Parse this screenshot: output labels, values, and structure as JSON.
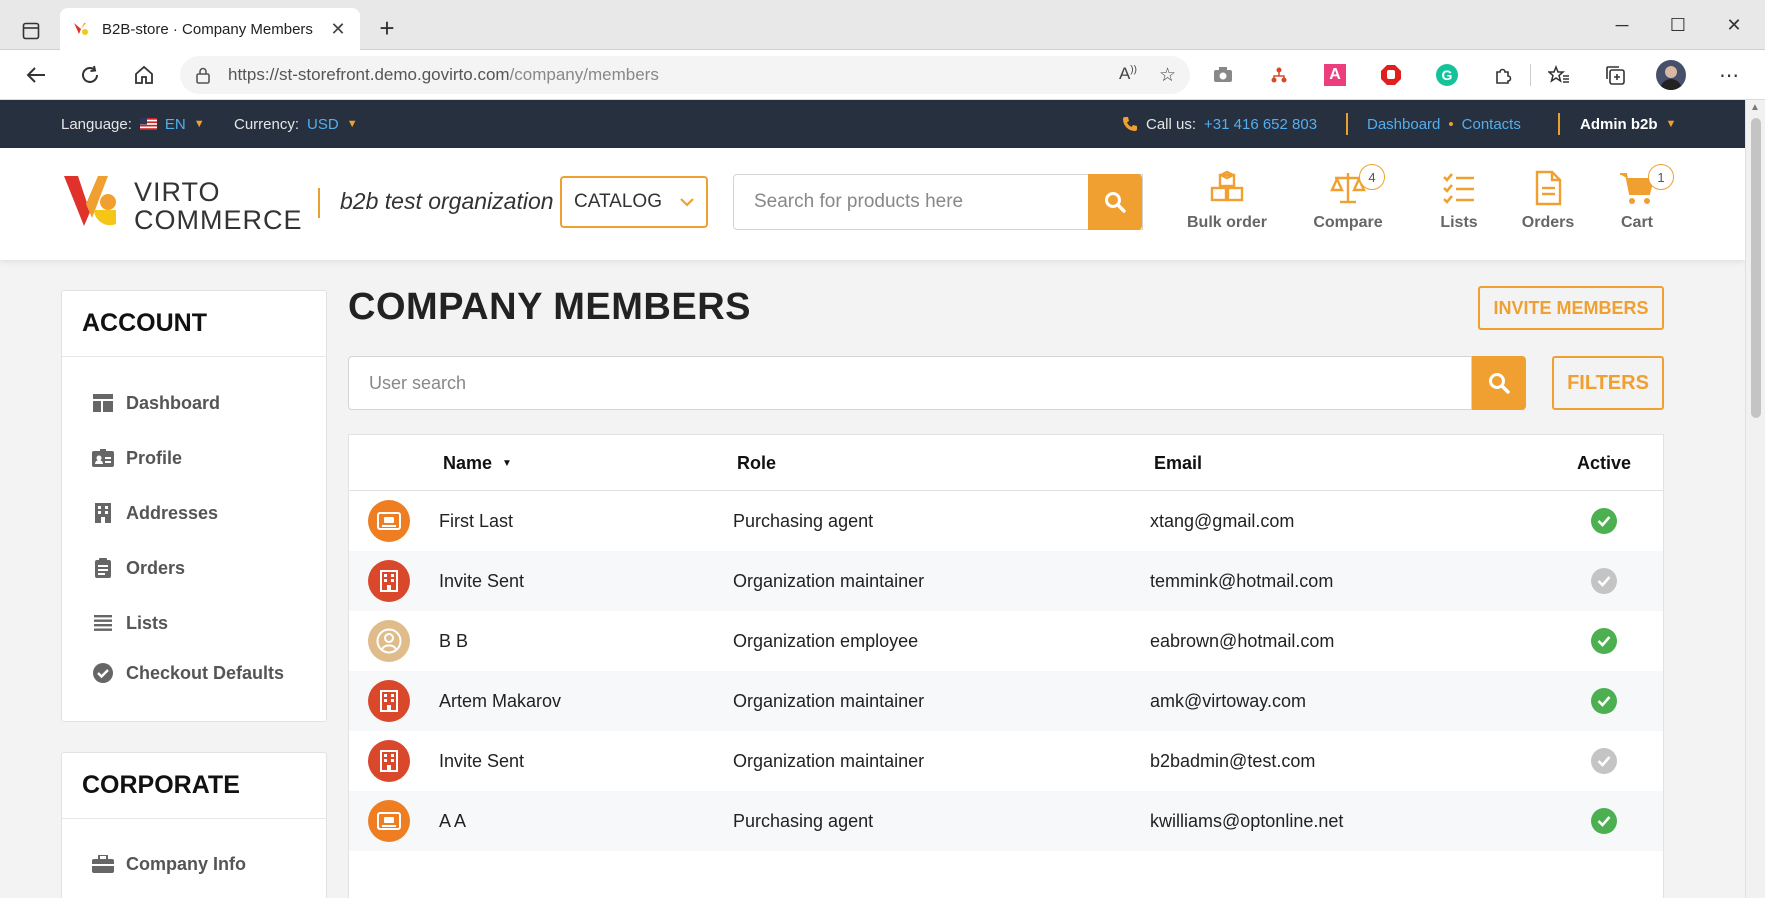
{
  "browser": {
    "tab_title": "B2B-store · Company Members",
    "url_host": "https://st-storefront.demo.govirto.com",
    "url_path": "/company/members"
  },
  "topbar": {
    "language_label": "Language:",
    "language_value": "EN",
    "currency_label": "Currency:",
    "currency_value": "USD",
    "call_label": "Call us:",
    "phone": "+31 416 652 803",
    "dashboard_link": "Dashboard",
    "contacts_link": "Contacts",
    "user_menu": "Admin b2b"
  },
  "header": {
    "logo_line1": "VIRTO",
    "logo_line2": "COMMERCE",
    "organization": "b2b test organization",
    "catalog_label": "CATALOG",
    "search_placeholder": "Search for products here",
    "links": {
      "bulk_order": "Bulk order",
      "compare": "Compare",
      "compare_count": "4",
      "lists": "Lists",
      "orders": "Orders",
      "cart": "Cart",
      "cart_count": "1"
    }
  },
  "sidebar": {
    "account_title": "ACCOUNT",
    "account_items": [
      "Dashboard",
      "Profile",
      "Addresses",
      "Orders",
      "Lists",
      "Checkout Defaults"
    ],
    "corporate_title": "CORPORATE",
    "corporate_items": [
      "Company Info"
    ]
  },
  "main": {
    "title": "COMPANY MEMBERS",
    "invite_label": "INVITE MEMBERS",
    "user_search_placeholder": "User search",
    "filters_label": "FILTERS",
    "columns": {
      "name": "Name",
      "role": "Role",
      "email": "Email",
      "active": "Active"
    },
    "rows": [
      {
        "name": "First Last",
        "role": "Purchasing agent",
        "email": "xtang@gmail.com",
        "avatar": "id-card-icon",
        "active": true
      },
      {
        "name": "Invite Sent",
        "role": "Organization maintainer",
        "email": "temmink@hotmail.com",
        "avatar": "building-icon",
        "active": false
      },
      {
        "name": "B B",
        "role": "Organization employee",
        "email": "eabrown@hotmail.com",
        "avatar": "user-icon",
        "active": true
      },
      {
        "name": "Artem Makarov",
        "role": "Organization maintainer",
        "email": "amk@virtoway.com",
        "avatar": "building-icon",
        "active": true
      },
      {
        "name": "Invite Sent",
        "role": "Organization maintainer",
        "email": "b2badmin@test.com",
        "avatar": "building-icon",
        "active": false
      },
      {
        "name": "A A",
        "role": "Purchasing agent",
        "email": "kwilliams@optonline.net",
        "avatar": "id-card-icon",
        "active": true
      }
    ]
  },
  "colors": {
    "accent": "#f0a030",
    "topbar_bg": "#26303f",
    "link_blue": "#53aef0",
    "active_green": "#4caf50",
    "inactive_gray": "#c4c4c4",
    "avatar_orange": "#ef7d22",
    "avatar_red": "#d9482a",
    "avatar_tan": "#dfbc8a"
  }
}
